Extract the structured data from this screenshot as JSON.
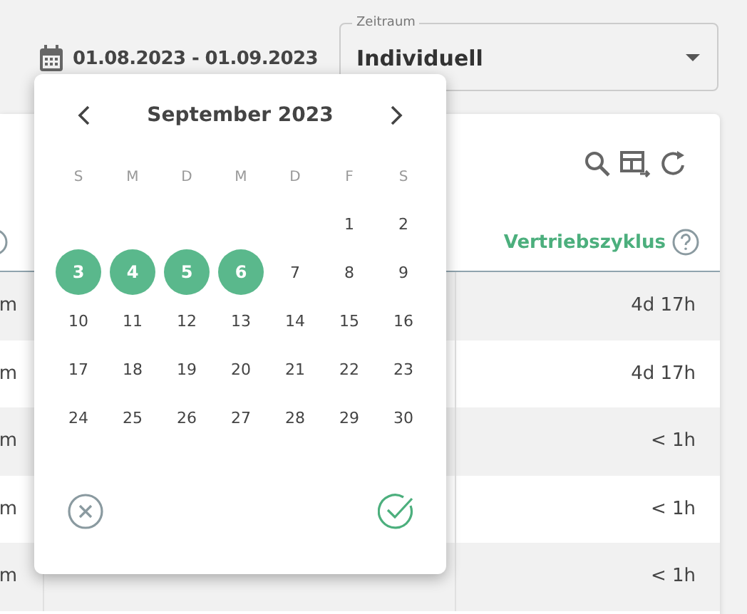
{
  "date_range": {
    "text": "01.08.2023 - 01.09.2023"
  },
  "period_select": {
    "label": "Zeitraum",
    "value": "Individuell"
  },
  "table": {
    "columns": [
      {
        "label": "Vertriebszyklus"
      }
    ],
    "rows": [
      {
        "column_1": "m",
        "column_3": "4d 17h"
      },
      {
        "column_1": "m",
        "column_3": "4d 17h"
      },
      {
        "column_1": "m",
        "column_3": "< 1h"
      },
      {
        "column_1": "m",
        "column_3": "< 1h"
      },
      {
        "column_1": "m",
        "column_3": "< 1h"
      }
    ]
  },
  "date_picker": {
    "month": "September 2023",
    "weekdays": [
      "S",
      "M",
      "D",
      "M",
      "D",
      "F",
      "S"
    ],
    "weeks": [
      {
        "days": [
          {
            "day": "1",
            "selected": false
          },
          {
            "day": "2",
            "selected": false
          }
        ]
      },
      {
        "days": [
          {
            "day": "3",
            "selected": true
          },
          {
            "day": "4",
            "selected": true
          },
          {
            "day": "5",
            "selected": true
          },
          {
            "day": "6",
            "selected": true
          },
          {
            "day": "7",
            "selected": false
          },
          {
            "day": "8",
            "selected": false
          },
          {
            "day": "9",
            "selected": false
          }
        ]
      },
      {
        "days": [
          {
            "day": "10",
            "selected": false
          },
          {
            "day": "11",
            "selected": false
          },
          {
            "day": "12",
            "selected": false
          },
          {
            "day": "13",
            "selected": false
          },
          {
            "day": "14",
            "selected": false
          },
          {
            "day": "15",
            "selected": false
          },
          {
            "day": "16",
            "selected": false
          }
        ]
      },
      {
        "days": [
          {
            "day": "17",
            "selected": false
          },
          {
            "day": "18",
            "selected": false
          },
          {
            "day": "19",
            "selected": false
          },
          {
            "day": "20",
            "selected": false
          },
          {
            "day": "21",
            "selected": false
          },
          {
            "day": "22",
            "selected": false
          },
          {
            "day": "23",
            "selected": false
          }
        ]
      },
      {
        "days": [
          {
            "day": "24",
            "selected": false
          },
          {
            "day": "25",
            "selected": false
          },
          {
            "day": "26",
            "selected": false
          },
          {
            "day": "27",
            "selected": false
          },
          {
            "day": "28",
            "selected": false
          },
          {
            "day": "29",
            "selected": false
          },
          {
            "day": "30",
            "selected": false
          }
        ]
      }
    ]
  }
}
